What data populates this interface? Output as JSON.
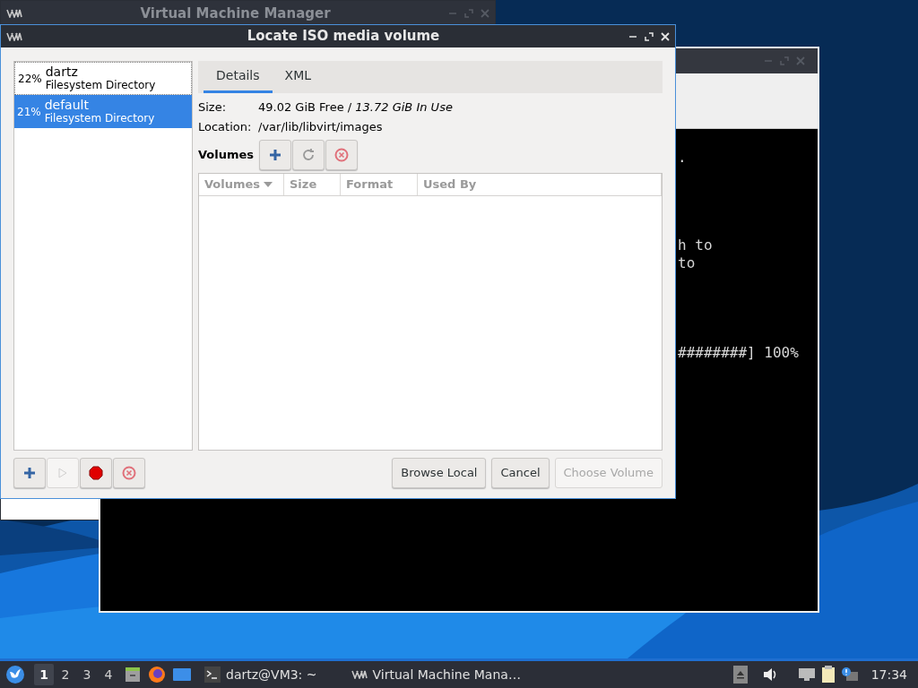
{
  "back_window": {
    "title": "Virtual Machine Manager"
  },
  "terminal": {
    "lines": [
      ".",
      "h to",
      "to",
      "########] 100%"
    ]
  },
  "dialog": {
    "title": "Locate ISO media volume",
    "pools": [
      {
        "usage": "22%",
        "name": "dartz",
        "type": "Filesystem Directory",
        "selected": false
      },
      {
        "usage": "21%",
        "name": "default",
        "type": "Filesystem Directory",
        "selected": true
      }
    ],
    "pool_tools": [
      {
        "kind": "add",
        "disabled": false
      },
      {
        "kind": "start",
        "disabled": true
      },
      {
        "kind": "stop",
        "disabled": false
      },
      {
        "kind": "delete",
        "disabled": false
      }
    ],
    "tabs": [
      {
        "label": "Details",
        "selected": true
      },
      {
        "label": "XML",
        "selected": false
      }
    ],
    "size_label": "Size:",
    "size_free": "49.02 GiB Free",
    "size_sep": "/",
    "size_in_use": "13.72 GiB In Use",
    "location_label": "Location:",
    "location": "/var/lib/libvirt/images",
    "volumes_label": "Volumes",
    "volume_tools": [
      {
        "kind": "add",
        "disabled": false
      },
      {
        "kind": "refresh",
        "disabled": false
      },
      {
        "kind": "delete",
        "disabled": false
      }
    ],
    "columns": [
      {
        "label": "Volumes",
        "sorted": true
      },
      {
        "label": "Size",
        "sorted": false
      },
      {
        "label": "Format",
        "sorted": false
      },
      {
        "label": "Used By",
        "sorted": false
      }
    ],
    "buttons": [
      {
        "label": "Browse Local",
        "disabled": false
      },
      {
        "label": "Cancel",
        "disabled": false
      },
      {
        "label": "Choose Volume",
        "disabled": true
      }
    ]
  },
  "taskbar": {
    "workspaces": [
      {
        "label": "1",
        "selected": true
      },
      {
        "label": "2",
        "selected": false
      },
      {
        "label": "3",
        "selected": false
      },
      {
        "label": "4",
        "selected": false
      }
    ],
    "tasks": [
      {
        "kind": "terminal",
        "label": "dartz@VM3: ~"
      },
      {
        "kind": "vmm",
        "label": "Virtual Machine Mana…"
      }
    ],
    "clock": "17:34"
  }
}
